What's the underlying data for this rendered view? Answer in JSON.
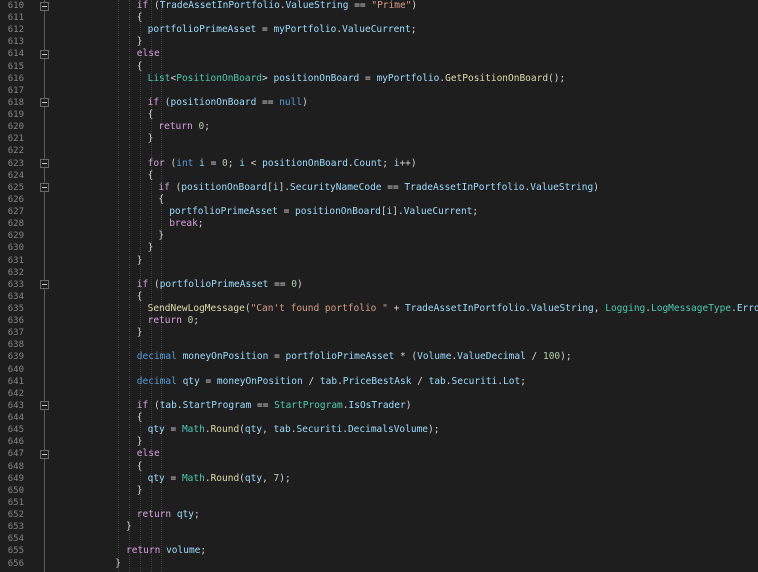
{
  "lines": [
    {
      "n": "610",
      "fold": true,
      "indent": 6,
      "tokens": [
        [
          "ctl",
          "if"
        ],
        [
          "pl",
          " ("
        ],
        [
          "var",
          "TradeAssetInPortfolio"
        ],
        [
          "pl",
          "."
        ],
        [
          "var",
          "ValueString"
        ],
        [
          "pl",
          " == "
        ],
        [
          "str",
          "\"Prime\""
        ],
        [
          "pl",
          ")"
        ]
      ]
    },
    {
      "n": "611",
      "fold": false,
      "indent": 6,
      "tokens": [
        [
          "pl",
          "{"
        ]
      ]
    },
    {
      "n": "612",
      "fold": false,
      "indent": 7,
      "tokens": [
        [
          "var",
          "portfolioPrimeAsset"
        ],
        [
          "pl",
          " = "
        ],
        [
          "var",
          "myPortfolio"
        ],
        [
          "pl",
          "."
        ],
        [
          "var",
          "ValueCurrent"
        ],
        [
          "pl",
          ";"
        ]
      ]
    },
    {
      "n": "613",
      "fold": false,
      "indent": 6,
      "tokens": [
        [
          "pl",
          "}"
        ]
      ]
    },
    {
      "n": "614",
      "fold": true,
      "indent": 6,
      "tokens": [
        [
          "ctl",
          "else"
        ]
      ]
    },
    {
      "n": "615",
      "fold": false,
      "indent": 6,
      "tokens": [
        [
          "pl",
          "{"
        ]
      ]
    },
    {
      "n": "616",
      "fold": false,
      "indent": 7,
      "tokens": [
        [
          "type",
          "List"
        ],
        [
          "pl",
          "<"
        ],
        [
          "type",
          "PositionOnBoard"
        ],
        [
          "pl",
          "> "
        ],
        [
          "var",
          "positionOnBoard"
        ],
        [
          "pl",
          " = "
        ],
        [
          "var",
          "myPortfolio"
        ],
        [
          "pl",
          "."
        ],
        [
          "fn",
          "GetPositionOnBoard"
        ],
        [
          "pl",
          "();"
        ]
      ]
    },
    {
      "n": "617",
      "fold": false,
      "indent": 0,
      "tokens": []
    },
    {
      "n": "618",
      "fold": true,
      "indent": 7,
      "tokens": [
        [
          "ctl",
          "if"
        ],
        [
          "pl",
          " ("
        ],
        [
          "var",
          "positionOnBoard"
        ],
        [
          "pl",
          " == "
        ],
        [
          "kw",
          "null"
        ],
        [
          "pl",
          ")"
        ]
      ]
    },
    {
      "n": "619",
      "fold": false,
      "indent": 7,
      "tokens": [
        [
          "pl",
          "{"
        ]
      ]
    },
    {
      "n": "620",
      "fold": false,
      "indent": 8,
      "tokens": [
        [
          "ctl",
          "return"
        ],
        [
          "pl",
          " "
        ],
        [
          "num",
          "0"
        ],
        [
          "pl",
          ";"
        ]
      ]
    },
    {
      "n": "621",
      "fold": false,
      "indent": 7,
      "tokens": [
        [
          "pl",
          "}"
        ]
      ]
    },
    {
      "n": "622",
      "fold": false,
      "indent": 0,
      "tokens": []
    },
    {
      "n": "623",
      "fold": true,
      "indent": 7,
      "tokens": [
        [
          "ctl",
          "for"
        ],
        [
          "pl",
          " ("
        ],
        [
          "kw",
          "int"
        ],
        [
          "pl",
          " "
        ],
        [
          "var",
          "i"
        ],
        [
          "pl",
          " = "
        ],
        [
          "num",
          "0"
        ],
        [
          "pl",
          "; "
        ],
        [
          "var",
          "i"
        ],
        [
          "pl",
          " < "
        ],
        [
          "var",
          "positionOnBoard"
        ],
        [
          "pl",
          "."
        ],
        [
          "var",
          "Count"
        ],
        [
          "pl",
          "; "
        ],
        [
          "var",
          "i"
        ],
        [
          "pl",
          "++)"
        ]
      ]
    },
    {
      "n": "624",
      "fold": false,
      "indent": 7,
      "tokens": [
        [
          "pl",
          "{"
        ]
      ]
    },
    {
      "n": "625",
      "fold": true,
      "indent": 8,
      "tokens": [
        [
          "ctl",
          "if"
        ],
        [
          "pl",
          " ("
        ],
        [
          "var",
          "positionOnBoard"
        ],
        [
          "pl",
          "["
        ],
        [
          "var",
          "i"
        ],
        [
          "pl",
          "]."
        ],
        [
          "var",
          "SecurityNameCode"
        ],
        [
          "pl",
          " == "
        ],
        [
          "var",
          "TradeAssetInPortfolio"
        ],
        [
          "pl",
          "."
        ],
        [
          "var",
          "ValueString"
        ],
        [
          "pl",
          ")"
        ]
      ]
    },
    {
      "n": "626",
      "fold": false,
      "indent": 8,
      "tokens": [
        [
          "pl",
          "{"
        ]
      ]
    },
    {
      "n": "627",
      "fold": false,
      "indent": 9,
      "tokens": [
        [
          "var",
          "portfolioPrimeAsset"
        ],
        [
          "pl",
          " = "
        ],
        [
          "var",
          "positionOnBoard"
        ],
        [
          "pl",
          "["
        ],
        [
          "var",
          "i"
        ],
        [
          "pl",
          "]."
        ],
        [
          "var",
          "ValueCurrent"
        ],
        [
          "pl",
          ";"
        ]
      ]
    },
    {
      "n": "628",
      "fold": false,
      "indent": 9,
      "tokens": [
        [
          "ctl",
          "break"
        ],
        [
          "pl",
          ";"
        ]
      ]
    },
    {
      "n": "629",
      "fold": false,
      "indent": 8,
      "tokens": [
        [
          "pl",
          "}"
        ]
      ]
    },
    {
      "n": "630",
      "fold": false,
      "indent": 7,
      "tokens": [
        [
          "pl",
          "}"
        ]
      ]
    },
    {
      "n": "631",
      "fold": false,
      "indent": 6,
      "tokens": [
        [
          "pl",
          "}"
        ]
      ]
    },
    {
      "n": "632",
      "fold": false,
      "indent": 0,
      "tokens": []
    },
    {
      "n": "633",
      "fold": true,
      "indent": 6,
      "tokens": [
        [
          "ctl",
          "if"
        ],
        [
          "pl",
          " ("
        ],
        [
          "var",
          "portfolioPrimeAsset"
        ],
        [
          "pl",
          " == "
        ],
        [
          "num",
          "0"
        ],
        [
          "pl",
          ")"
        ]
      ]
    },
    {
      "n": "634",
      "fold": false,
      "indent": 6,
      "tokens": [
        [
          "pl",
          "{"
        ]
      ]
    },
    {
      "n": "635",
      "fold": false,
      "indent": 7,
      "tokens": [
        [
          "fn",
          "SendNewLogMessage"
        ],
        [
          "pl",
          "("
        ],
        [
          "str",
          "\"Can't found portfolio \""
        ],
        [
          "pl",
          " + "
        ],
        [
          "var",
          "TradeAssetInPortfolio"
        ],
        [
          "pl",
          "."
        ],
        [
          "var",
          "ValueString"
        ],
        [
          "pl",
          ", "
        ],
        [
          "type",
          "Logging"
        ],
        [
          "pl",
          "."
        ],
        [
          "type",
          "LogMessageType"
        ],
        [
          "pl",
          "."
        ],
        [
          "var",
          "Error"
        ],
        [
          "pl",
          ");"
        ]
      ]
    },
    {
      "n": "636",
      "fold": false,
      "indent": 7,
      "tokens": [
        [
          "ctl",
          "return"
        ],
        [
          "pl",
          " "
        ],
        [
          "num",
          "0"
        ],
        [
          "pl",
          ";"
        ]
      ]
    },
    {
      "n": "637",
      "fold": false,
      "indent": 6,
      "tokens": [
        [
          "pl",
          "}"
        ]
      ]
    },
    {
      "n": "638",
      "fold": false,
      "indent": 0,
      "tokens": []
    },
    {
      "n": "639",
      "fold": false,
      "indent": 6,
      "tokens": [
        [
          "kw",
          "decimal"
        ],
        [
          "pl",
          " "
        ],
        [
          "var",
          "moneyOnPosition"
        ],
        [
          "pl",
          " = "
        ],
        [
          "var",
          "portfolioPrimeAsset"
        ],
        [
          "pl",
          " * ("
        ],
        [
          "var",
          "Volume"
        ],
        [
          "pl",
          "."
        ],
        [
          "var",
          "ValueDecimal"
        ],
        [
          "pl",
          " / "
        ],
        [
          "num",
          "100"
        ],
        [
          "pl",
          ");"
        ]
      ]
    },
    {
      "n": "640",
      "fold": false,
      "indent": 0,
      "tokens": []
    },
    {
      "n": "641",
      "fold": false,
      "indent": 6,
      "tokens": [
        [
          "kw",
          "decimal"
        ],
        [
          "pl",
          " "
        ],
        [
          "var",
          "qty"
        ],
        [
          "pl",
          " = "
        ],
        [
          "var",
          "moneyOnPosition"
        ],
        [
          "pl",
          " / "
        ],
        [
          "var",
          "tab"
        ],
        [
          "pl",
          "."
        ],
        [
          "var",
          "PriceBestAsk"
        ],
        [
          "pl",
          " / "
        ],
        [
          "var",
          "tab"
        ],
        [
          "pl",
          "."
        ],
        [
          "var",
          "Securiti"
        ],
        [
          "pl",
          "."
        ],
        [
          "var",
          "Lot"
        ],
        [
          "pl",
          ";"
        ]
      ]
    },
    {
      "n": "642",
      "fold": false,
      "indent": 0,
      "tokens": []
    },
    {
      "n": "643",
      "fold": true,
      "indent": 6,
      "tokens": [
        [
          "ctl",
          "if"
        ],
        [
          "pl",
          " ("
        ],
        [
          "var",
          "tab"
        ],
        [
          "pl",
          "."
        ],
        [
          "var",
          "StartProgram"
        ],
        [
          "pl",
          " == "
        ],
        [
          "type",
          "StartProgram"
        ],
        [
          "pl",
          "."
        ],
        [
          "var",
          "IsOsTrader"
        ],
        [
          "pl",
          ")"
        ]
      ]
    },
    {
      "n": "644",
      "fold": false,
      "indent": 6,
      "tokens": [
        [
          "pl",
          "{"
        ]
      ]
    },
    {
      "n": "645",
      "fold": false,
      "indent": 7,
      "tokens": [
        [
          "var",
          "qty"
        ],
        [
          "pl",
          " = "
        ],
        [
          "type",
          "Math"
        ],
        [
          "pl",
          "."
        ],
        [
          "fn",
          "Round"
        ],
        [
          "pl",
          "("
        ],
        [
          "var",
          "qty"
        ],
        [
          "pl",
          ", "
        ],
        [
          "var",
          "tab"
        ],
        [
          "pl",
          "."
        ],
        [
          "var",
          "Securiti"
        ],
        [
          "pl",
          "."
        ],
        [
          "var",
          "DecimalsVolume"
        ],
        [
          "pl",
          ");"
        ]
      ]
    },
    {
      "n": "646",
      "fold": false,
      "indent": 6,
      "tokens": [
        [
          "pl",
          "}"
        ]
      ]
    },
    {
      "n": "647",
      "fold": true,
      "indent": 6,
      "tokens": [
        [
          "ctl",
          "else"
        ]
      ]
    },
    {
      "n": "648",
      "fold": false,
      "indent": 6,
      "tokens": [
        [
          "pl",
          "{"
        ]
      ]
    },
    {
      "n": "649",
      "fold": false,
      "indent": 7,
      "tokens": [
        [
          "var",
          "qty"
        ],
        [
          "pl",
          " = "
        ],
        [
          "type",
          "Math"
        ],
        [
          "pl",
          "."
        ],
        [
          "fn",
          "Round"
        ],
        [
          "pl",
          "("
        ],
        [
          "var",
          "qty"
        ],
        [
          "pl",
          ", "
        ],
        [
          "num",
          "7"
        ],
        [
          "pl",
          ");"
        ]
      ]
    },
    {
      "n": "650",
      "fold": false,
      "indent": 6,
      "tokens": [
        [
          "pl",
          "}"
        ]
      ]
    },
    {
      "n": "651",
      "fold": false,
      "indent": 0,
      "tokens": []
    },
    {
      "n": "652",
      "fold": false,
      "indent": 6,
      "tokens": [
        [
          "ctl",
          "return"
        ],
        [
          "pl",
          " "
        ],
        [
          "var",
          "qty"
        ],
        [
          "pl",
          ";"
        ]
      ]
    },
    {
      "n": "653",
      "fold": false,
      "indent": 5,
      "tokens": [
        [
          "pl",
          "}"
        ]
      ]
    },
    {
      "n": "654",
      "fold": false,
      "indent": 0,
      "tokens": []
    },
    {
      "n": "655",
      "fold": false,
      "indent": 5,
      "tokens": [
        [
          "ctl",
          "return"
        ],
        [
          "pl",
          " "
        ],
        [
          "var",
          "volume"
        ],
        [
          "pl",
          ";"
        ]
      ]
    },
    {
      "n": "656",
      "fold": false,
      "indent": 4,
      "tokens": [
        [
          "pl",
          "}"
        ]
      ]
    }
  ],
  "colors": {
    "background": "#1e1e1e",
    "line_number": "#858585",
    "keyword": "#569cd6",
    "control": "#d8a0df",
    "type": "#4ec9b0",
    "variable": "#9cdcfe",
    "method": "#dcdcaa",
    "string": "#d69d85",
    "number": "#b5cea8"
  }
}
